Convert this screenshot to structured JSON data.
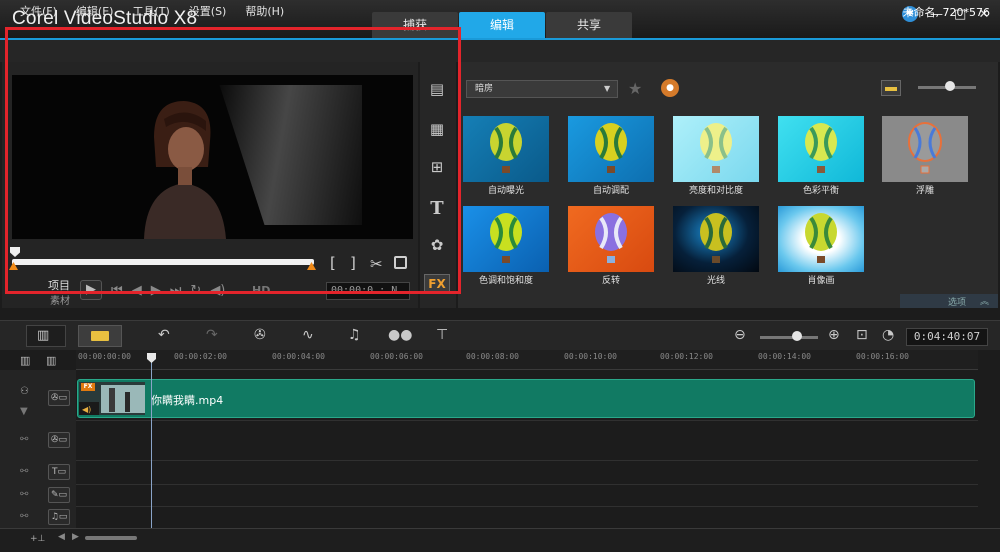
{
  "app": {
    "title": "Corel  VideoStudio X8",
    "project_info": "未命名, 720*576"
  },
  "tabs": [
    {
      "label": "捕获"
    },
    {
      "label": "编辑"
    },
    {
      "label": "共享"
    }
  ],
  "menu": [
    "文件(F)",
    "编辑(E)",
    "工具(T)",
    "设置(S)",
    "帮助(H)"
  ],
  "player": {
    "label_project": "项目",
    "label_clip": "素材",
    "hd_label": "HD",
    "timecode": "00:00:0 : N"
  },
  "library": {
    "category": "暗房",
    "filters": [
      {
        "label": "自动曝光"
      },
      {
        "label": "自动调配"
      },
      {
        "label": "亮度和对比度"
      },
      {
        "label": "色彩平衡"
      },
      {
        "label": "浮雕"
      },
      {
        "label": "色调和饱和度"
      },
      {
        "label": "反转"
      },
      {
        "label": "光线"
      },
      {
        "label": "肖像画"
      }
    ],
    "options_label": "选项"
  },
  "timeline": {
    "duration": "0:04:40:07",
    "ruler_labels": [
      "00:00:00:00",
      "00:00:02:00",
      "00:00:04:00",
      "00:00:06:00",
      "00:00:08:00",
      "00:00:10:00",
      "00:00:12:00",
      "00:00:14:00",
      "00:00:16:00"
    ],
    "clip_name": "你瞒我瞒.mp4",
    "clip_fx": "FX"
  },
  "colors": {
    "accent": "#21a8e8",
    "clip": "#117a63",
    "highlight_box": "#e3242b"
  }
}
